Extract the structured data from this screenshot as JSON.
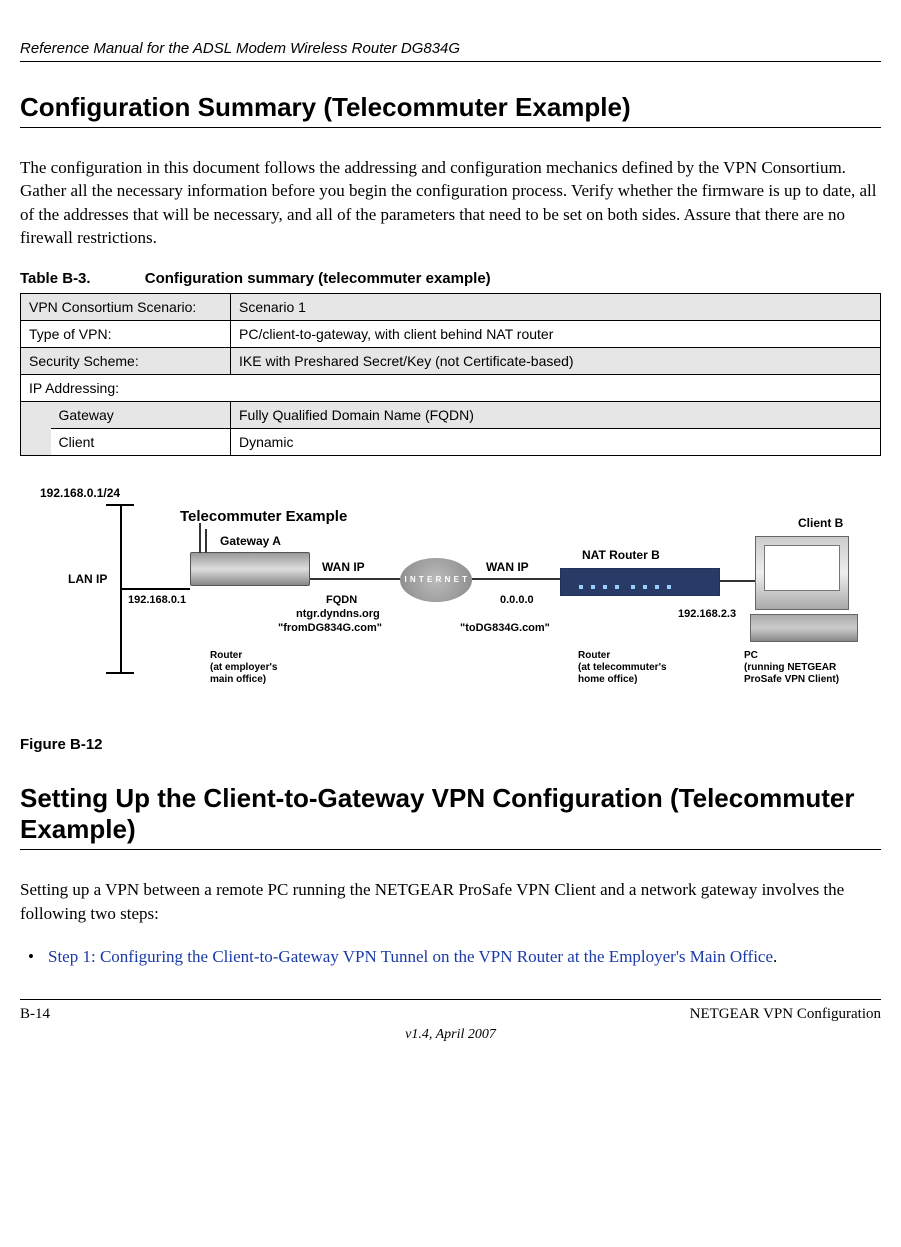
{
  "header": {
    "running_title": "Reference Manual for the ADSL Modem Wireless Router DG834G"
  },
  "section1": {
    "heading": "Configuration Summary (Telecommuter Example)",
    "paragraph": "The configuration in this document follows the addressing and configuration mechanics defined by the VPN Consortium. Gather all the necessary information before you begin the configuration process. Verify whether the firmware is up to date, all of the addresses that will be necessary, and all of the parameters that need to be set on both sides. Assure that there are no firewall restrictions."
  },
  "table": {
    "number": "Table B-3.",
    "title": "Configuration summary (telecommuter example)",
    "rows": {
      "vpn_scenario_k": "VPN Consortium Scenario:",
      "vpn_scenario_v": "Scenario 1",
      "type_k": "Type of VPN:",
      "type_v": "PC/client-to-gateway, with client behind NAT router",
      "sec_k": "Security Scheme:",
      "sec_v": "IKE with Preshared Secret/Key (not Certificate-based)",
      "ip_k": "IP Addressing:",
      "gw_k": "Gateway",
      "gw_v": "Fully Qualified Domain Name (FQDN)",
      "cl_k": "Client",
      "cl_v": "Dynamic"
    }
  },
  "diagram": {
    "title": "Telecommuter Example",
    "subnet": "192.168.0.1/24",
    "lan_ip_label": "LAN IP",
    "lan_ip": "192.168.0.1",
    "gateway_a": "Gateway A",
    "wan_ip_label_a": "WAN IP",
    "fqdn_label": "FQDN",
    "fqdn_value": "ntgr.dyndns.org",
    "from_name": "\"fromDG834G.com\"",
    "cloud": "I N T E R N E T",
    "wan_ip_label_b": "WAN IP",
    "wan_ip_b": "0.0.0.0",
    "to_name": "\"toDG834G.com\"",
    "nat_router_b": "NAT Router B",
    "client_b": "Client B",
    "client_ip": "192.168.2.3",
    "note_a1": "Router",
    "note_a2": "(at employer's",
    "note_a3": "main office)",
    "note_b1": "Router",
    "note_b2": "(at telecommuter's",
    "note_b3": "home office)",
    "note_c1": "PC",
    "note_c2": "(running NETGEAR",
    "note_c3": "ProSafe VPN Client)"
  },
  "figure_caption": "Figure B-12",
  "section2": {
    "heading": "Setting Up the Client-to-Gateway VPN Configuration (Telecommuter Example)",
    "paragraph": "Setting up a VPN between a remote PC running the NETGEAR ProSafe VPN Client and a network gateway involves the following two steps:",
    "step1": "Step 1: Configuring the Client-to-Gateway VPN Tunnel on the VPN Router at the Employer's Main Office",
    "step1_suffix": "."
  },
  "footer": {
    "left": "B-14",
    "right": "NETGEAR VPN Configuration",
    "center": "v1.4, April 2007"
  }
}
